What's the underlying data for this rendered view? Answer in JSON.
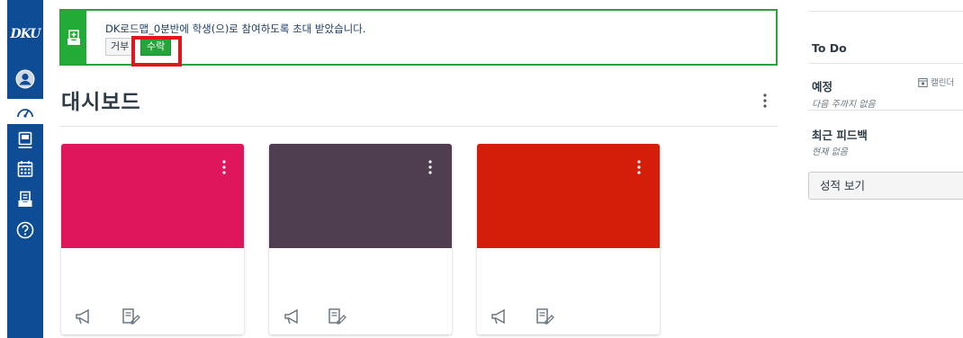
{
  "nav": {
    "logo": "DKU",
    "items": [
      {
        "icon": "account-icon"
      },
      {
        "icon": "dashboard-icon"
      },
      {
        "icon": "courses-icon"
      },
      {
        "icon": "calendar-icon"
      },
      {
        "icon": "inbox-icon"
      },
      {
        "icon": "help-icon"
      }
    ]
  },
  "notice": {
    "message": "DK로드맵_0분반에 학생(으)로 참여하도록 초대 받았습니다.",
    "decline_label": "거부",
    "accept_label": "수락"
  },
  "dashboard": {
    "title": "대시보드"
  },
  "cards": [
    {
      "color": "#e0165c",
      "icons": [
        "announcement-icon",
        "assignment-icon"
      ]
    },
    {
      "color": "#4f3d50",
      "icons": [
        "announcement-icon",
        "assignment-icon"
      ]
    },
    {
      "color": "#d41e0a",
      "icons": [
        "announcement-icon",
        "assignment-icon"
      ]
    }
  ],
  "sidebar": {
    "todo_title": "To Do",
    "coming_up_title": "예정",
    "calendar_link": "캘린더",
    "coming_up_note": "다음 주까지 없음",
    "feedback_title": "최근 피드백",
    "feedback_note": "현재 없음",
    "grades_button": "성적 보기"
  },
  "colors": {
    "nav": "#0e4c96",
    "accent_green": "#27a33c",
    "highlight_red": "#e0161c"
  }
}
